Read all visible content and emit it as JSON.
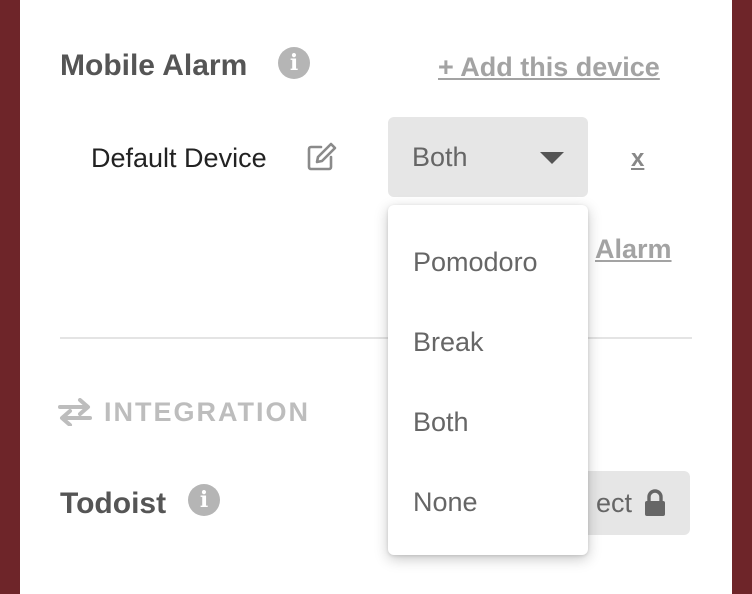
{
  "mobile_alarm": {
    "title": "Mobile Alarm",
    "info_icon": "info-icon",
    "add_device_label": "+ Add this device",
    "device": {
      "name": "Default Device",
      "edit_icon": "edit-icon",
      "selected": "Both",
      "remove_label": "x"
    },
    "test_link_label": "Alarm",
    "dropdown_options": [
      "Pomodoro",
      "Break",
      "Both",
      "None"
    ]
  },
  "integration": {
    "icon": "arrows-exchange-icon",
    "heading": "INTEGRATION",
    "todoist": {
      "title": "Todoist",
      "info_icon": "info-icon",
      "connect_label": "ect",
      "lock_icon": "lock-icon"
    }
  },
  "colors": {
    "frame": "#6e2529",
    "heading_text": "#555555",
    "muted_link": "#a3a3a3",
    "control_bg": "#e6e6e6"
  }
}
